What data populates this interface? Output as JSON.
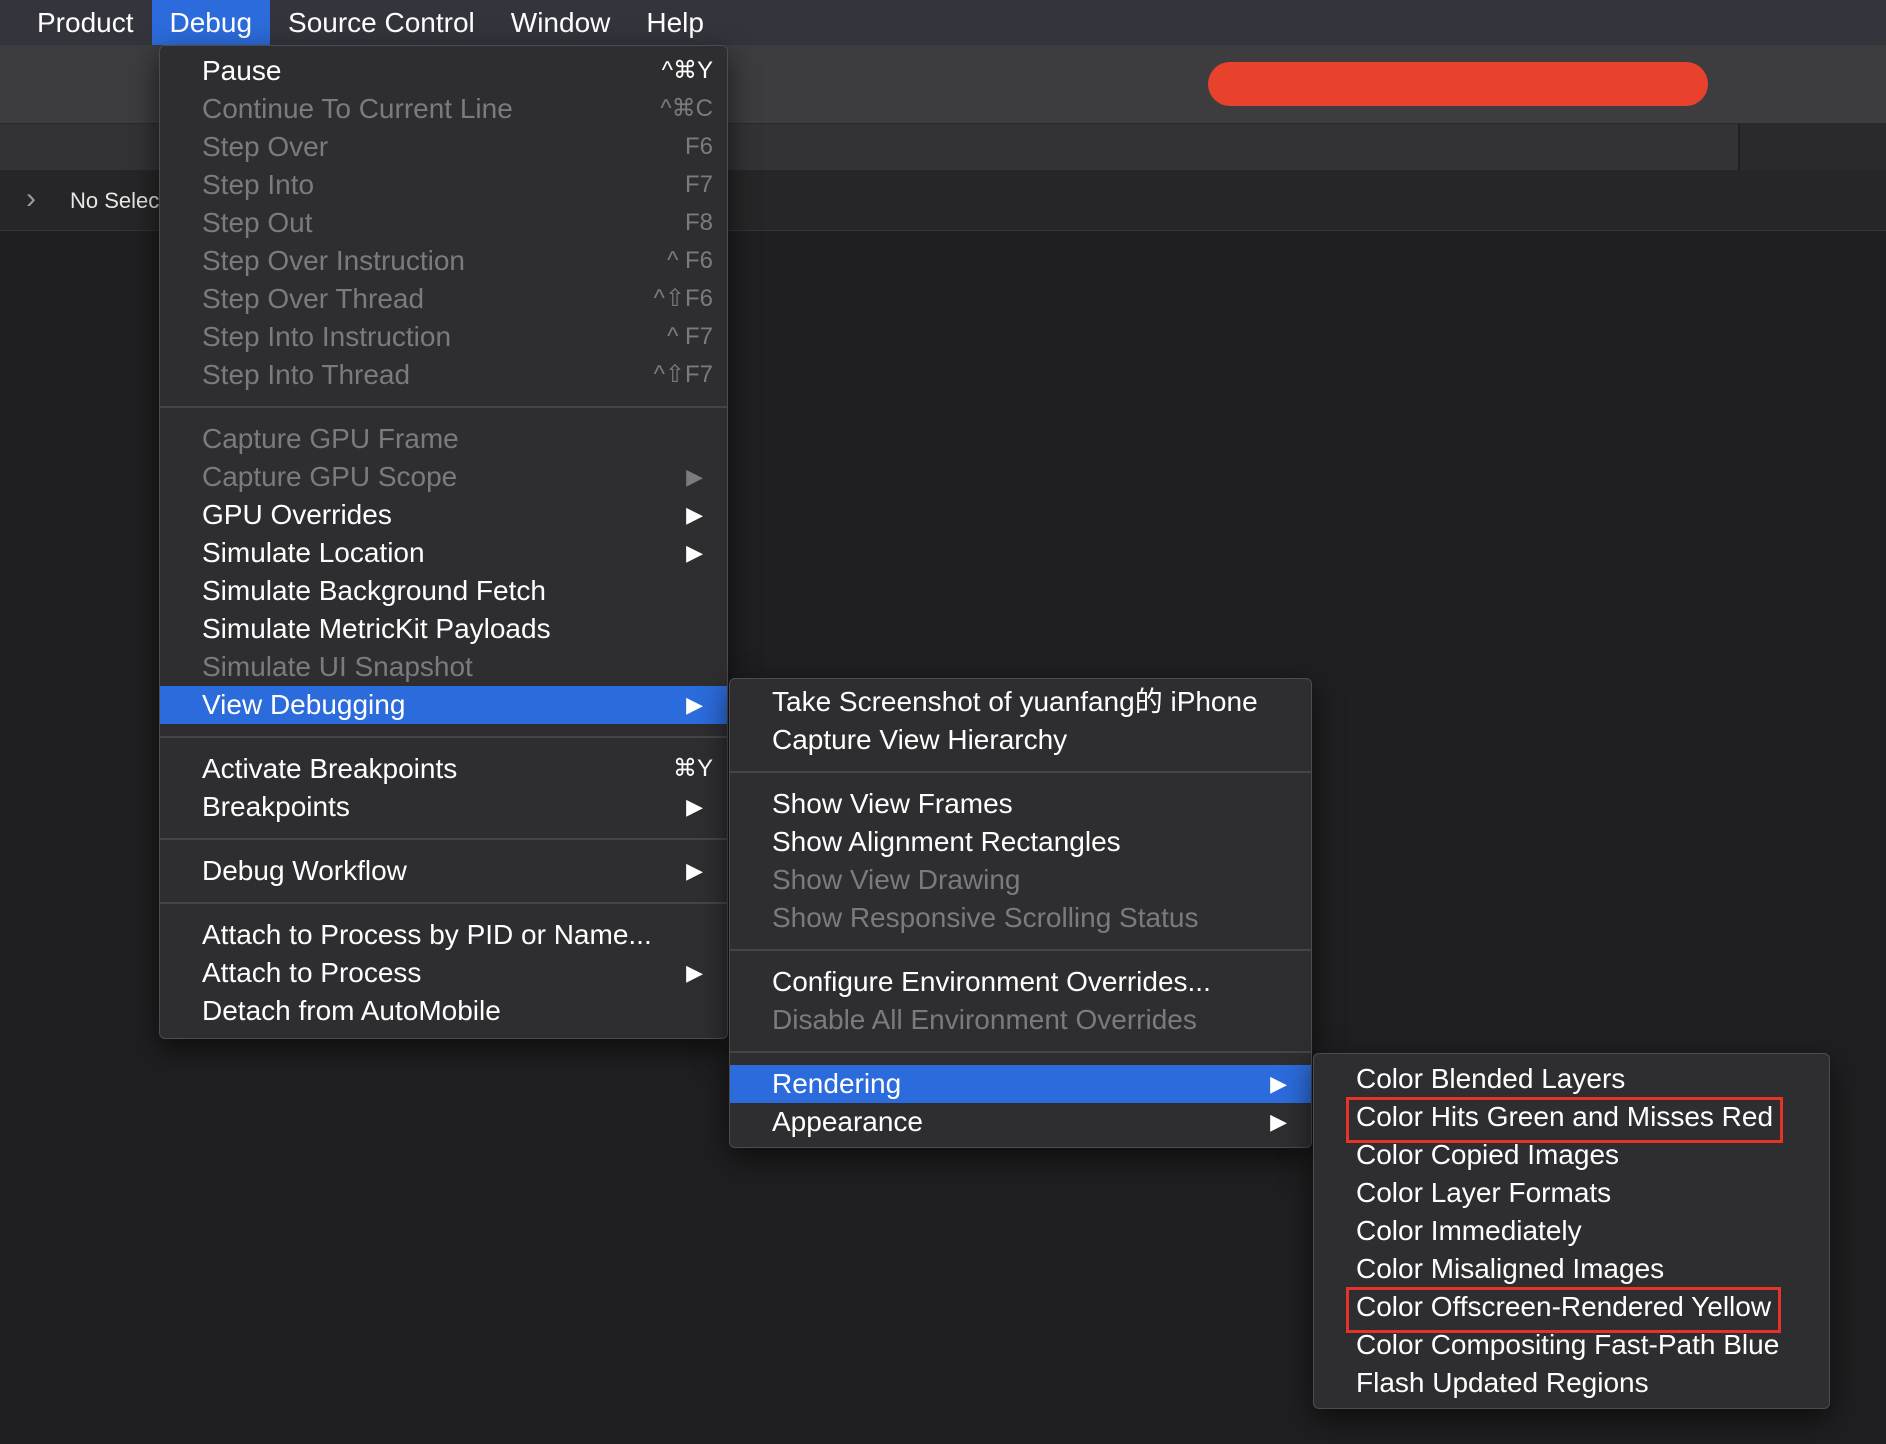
{
  "menubar": {
    "items": [
      "Product",
      "Debug",
      "Source Control",
      "Window",
      "Help"
    ],
    "active": "Debug"
  },
  "jumpbar": {
    "label": "No Selec"
  },
  "debug_menu": {
    "groups": [
      [
        {
          "label": "Pause",
          "shortcut": "^⌘Y",
          "enabled": true
        },
        {
          "label": "Continue To Current Line",
          "shortcut": "^⌘C",
          "enabled": false
        },
        {
          "label": "Step Over",
          "shortcut": "F6",
          "enabled": false
        },
        {
          "label": "Step Into",
          "shortcut": "F7",
          "enabled": false
        },
        {
          "label": "Step Out",
          "shortcut": "F8",
          "enabled": false
        },
        {
          "label": "Step Over Instruction",
          "shortcut": "^ F6",
          "enabled": false
        },
        {
          "label": "Step Over Thread",
          "shortcut": "^⇧F6",
          "enabled": false
        },
        {
          "label": "Step Into Instruction",
          "shortcut": "^ F7",
          "enabled": false
        },
        {
          "label": "Step Into Thread",
          "shortcut": "^⇧F7",
          "enabled": false
        }
      ],
      [
        {
          "label": "Capture GPU Frame",
          "enabled": false
        },
        {
          "label": "Capture GPU Scope",
          "enabled": false,
          "submenu": true
        },
        {
          "label": "GPU Overrides",
          "enabled": true,
          "submenu": true
        },
        {
          "label": "Simulate Location",
          "enabled": true,
          "submenu": true
        },
        {
          "label": "Simulate Background Fetch",
          "enabled": true
        },
        {
          "label": "Simulate MetricKit Payloads",
          "enabled": true
        },
        {
          "label": "Simulate UI Snapshot",
          "enabled": false
        },
        {
          "label": "View Debugging",
          "enabled": true,
          "submenu": true,
          "highlighted": true
        }
      ],
      [
        {
          "label": "Activate Breakpoints",
          "shortcut": "⌘Y",
          "enabled": true
        },
        {
          "label": "Breakpoints",
          "enabled": true,
          "submenu": true
        }
      ],
      [
        {
          "label": "Debug Workflow",
          "enabled": true,
          "submenu": true
        }
      ],
      [
        {
          "label": "Attach to Process by PID or Name...",
          "enabled": true
        },
        {
          "label": "Attach to Process",
          "enabled": true,
          "submenu": true
        },
        {
          "label": "Detach from AutoMobile",
          "enabled": true
        }
      ]
    ]
  },
  "view_debugging_menu": {
    "groups": [
      [
        {
          "label": "Take Screenshot of yuanfang的 iPhone",
          "enabled": true
        },
        {
          "label": "Capture View Hierarchy",
          "enabled": true
        }
      ],
      [
        {
          "label": "Show View Frames",
          "enabled": true
        },
        {
          "label": "Show Alignment Rectangles",
          "enabled": true
        },
        {
          "label": "Show View Drawing",
          "enabled": false
        },
        {
          "label": "Show Responsive Scrolling Status",
          "enabled": false
        }
      ],
      [
        {
          "label": "Configure Environment Overrides...",
          "enabled": true
        },
        {
          "label": "Disable All Environment Overrides",
          "enabled": false
        }
      ],
      [
        {
          "label": "Rendering",
          "enabled": true,
          "submenu": true,
          "highlighted": true
        },
        {
          "label": "Appearance",
          "enabled": true,
          "submenu": true
        }
      ]
    ]
  },
  "rendering_menu": {
    "items": [
      {
        "label": "Color Blended Layers",
        "enabled": true
      },
      {
        "label": "Color Hits Green and Misses Red",
        "enabled": true,
        "boxed": true
      },
      {
        "label": "Color Copied Images",
        "enabled": true
      },
      {
        "label": "Color Layer Formats",
        "enabled": true
      },
      {
        "label": "Color Immediately",
        "enabled": true
      },
      {
        "label": "Color Misaligned Images",
        "enabled": true
      },
      {
        "label": "Color Offscreen-Rendered Yellow",
        "enabled": true,
        "boxed": true
      },
      {
        "label": "Color Compositing Fast-Path Blue",
        "enabled": true
      },
      {
        "label": "Flash Updated Regions",
        "enabled": true
      }
    ]
  },
  "colors": {
    "highlight": "#2c6bdb",
    "annotation_box": "#e4332a",
    "redaction": "#e8412c"
  }
}
